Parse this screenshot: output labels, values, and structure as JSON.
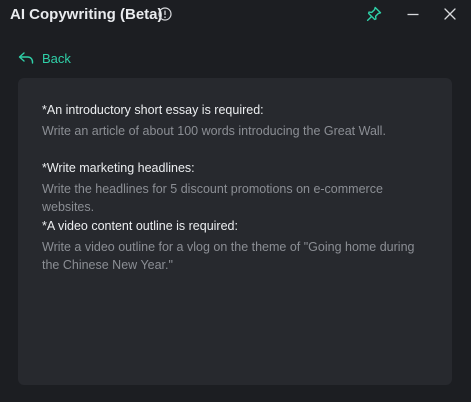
{
  "app": {
    "title": "AI Copywriting (Beta)"
  },
  "icons": {
    "info": "info-circle-icon",
    "pin": "pin-icon",
    "minimize": "minimize-icon",
    "close": "close-icon",
    "back": "back-arrow-icon"
  },
  "nav": {
    "back_label": "Back"
  },
  "colors": {
    "background": "#1c1e22",
    "card": "#27292e",
    "accent": "#2fd0a8",
    "title_text": "#eceef0",
    "muted_text": "#8b8e94"
  },
  "prompts": [
    {
      "title": "*An introductory short essay is required:",
      "description": "Write an article of about 100 words introducing the Great Wall."
    },
    {
      "title": "*Write marketing headlines:",
      "description": "Write the headlines for 5 discount promotions on e-commerce websites."
    },
    {
      "title": "*A video content outline is required:",
      "description": "Write a video outline for a vlog on the theme of \"Going home during the Chinese New Year.\""
    }
  ]
}
